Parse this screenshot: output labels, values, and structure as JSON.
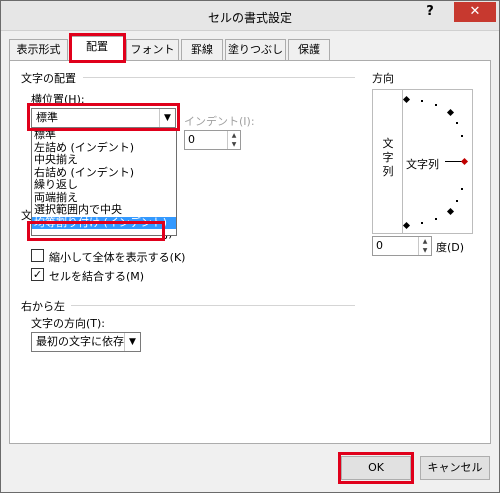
{
  "window": {
    "title": "セルの書式設定",
    "help": "?",
    "close": "✕"
  },
  "tabs": [
    {
      "label": "表示形式",
      "active": false
    },
    {
      "label": "配置",
      "active": true
    },
    {
      "label": "フォント",
      "active": false
    },
    {
      "label": "罫線",
      "active": false
    },
    {
      "label": "塗りつぶし",
      "active": false
    },
    {
      "label": "保護",
      "active": false
    }
  ],
  "alignment": {
    "group_title": "文字の配置",
    "horizontal_label": "横位置(H):",
    "horizontal_value": "標準",
    "horizontal_options": [
      "標準",
      "左詰め (インデント)",
      "中央揃え",
      "右詰め (インデント)",
      "繰り返し",
      "両端揃え",
      "選択範囲内で中央",
      "均等割り付け (インデント)"
    ],
    "selected_option_index": 7,
    "indent_label": "インデント(I):",
    "indent_value": "0",
    "control_group_initial": "文",
    "partial_checkbox_suffix": "J)"
  },
  "text_control": {
    "shrink_label": "縮小して全体を表示する(K)",
    "shrink_checked": false,
    "merge_label": "セルを結合する(M)",
    "merge_checked": true
  },
  "rtl": {
    "group_title": "右から左",
    "direction_label": "文字の方向(T):",
    "direction_value": "最初の文字に依存"
  },
  "orientation": {
    "group_title": "方向",
    "vertical_text": "文字列",
    "sample_text": "文字列",
    "degree_value": "0",
    "degree_label": "度(D)"
  },
  "buttons": {
    "ok": "OK",
    "cancel": "キャンセル"
  }
}
